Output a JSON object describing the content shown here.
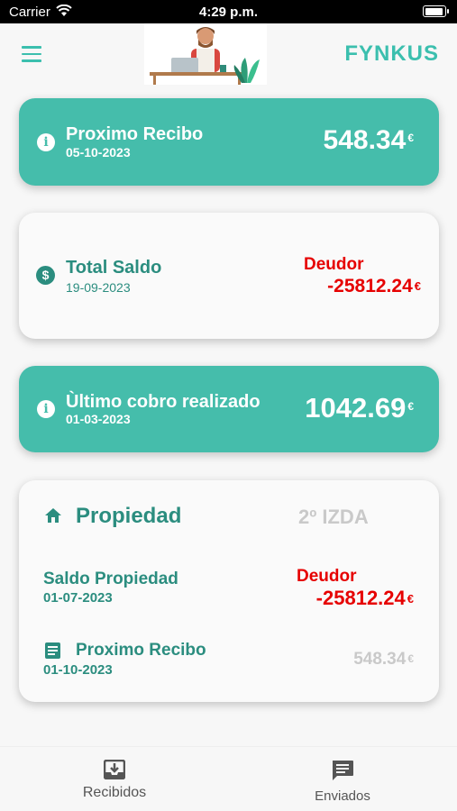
{
  "status": {
    "carrier": "Carrier",
    "time": "4:29 p.m."
  },
  "header": {
    "logo": "FYNKUS"
  },
  "card_next_receipt": {
    "title": "Proximo Recibo",
    "date": "05-10-2023",
    "amount": "548.34",
    "currency": "€"
  },
  "card_total_balance": {
    "title": "Total Saldo",
    "date": "19-09-2023",
    "status": "Deudor",
    "amount": "-25812.24",
    "currency": "€"
  },
  "card_last_payment": {
    "title": "Ùltimo cobro realizado",
    "date": "01-03-2023",
    "amount": "1042.69",
    "currency": "€"
  },
  "card_property": {
    "title": "Propiedad",
    "unit": "2º IZDA",
    "balance_label": "Saldo Propiedad",
    "balance_date": "01-07-2023",
    "balance_status": "Deudor",
    "balance_amount": "-25812.24",
    "balance_currency": "€",
    "receipt_label": "Proximo Recibo",
    "receipt_date": "01-10-2023",
    "receipt_amount": "548.34",
    "receipt_currency": "€"
  },
  "tabs": [
    {
      "label": "Recibidos",
      "icon": "inbox-icon"
    },
    {
      "label": "Enviados",
      "icon": "message-icon"
    }
  ],
  "colors": {
    "accent": "#45bdab",
    "dark_accent": "#2b8d7f",
    "debt": "#e60000"
  }
}
